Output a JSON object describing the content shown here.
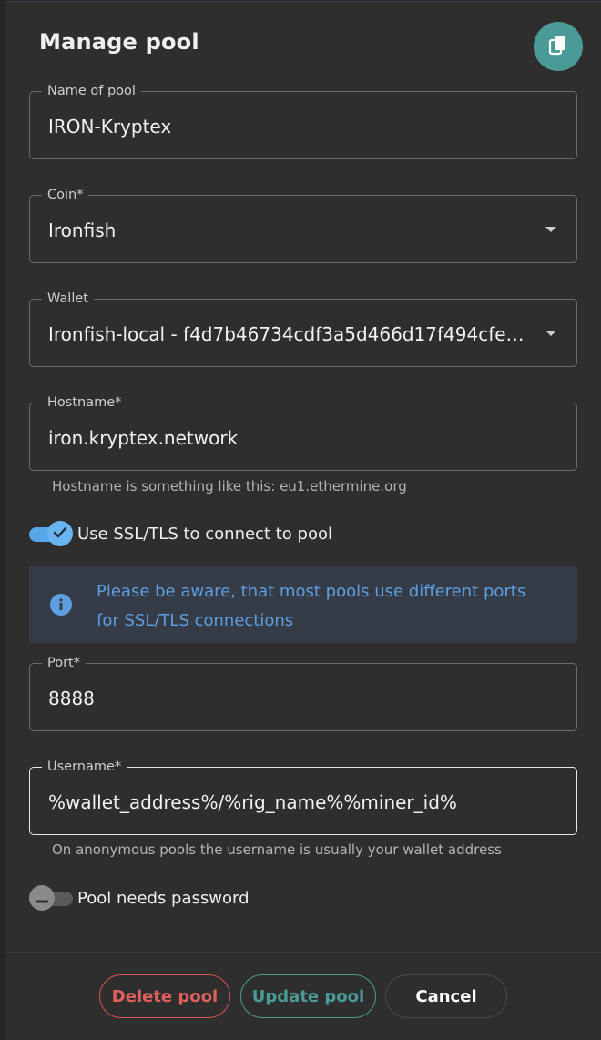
{
  "dialog": {
    "title": "Manage pool"
  },
  "fields": {
    "pool_name": {
      "label": "Name of pool",
      "value": "IRON-Kryptex"
    },
    "coin": {
      "label": "Coin*",
      "value": "Ironfish"
    },
    "wallet": {
      "label": "Wallet",
      "value": "Ironfish-local - f4d7b46734cdf3a5d466d17f494cfe…"
    },
    "hostname": {
      "label": "Hostname*",
      "value": "iron.kryptex.network",
      "helper": "Hostname is something like this: eu1.ethermine.org"
    },
    "port": {
      "label": "Port*",
      "value": "8888"
    },
    "username": {
      "label": "Username*",
      "value": "%wallet_address%/%rig_name%%miner_id%",
      "helper": "On anonymous pools the username is usually your wallet address"
    }
  },
  "toggles": {
    "ssl": {
      "label": "Use SSL/TLS to connect to pool",
      "checked": true
    },
    "password": {
      "label": "Pool needs password",
      "checked": false
    }
  },
  "alert": {
    "text": "Please be aware, that most pools use different ports for SSL/TLS connections"
  },
  "buttons": {
    "delete": "Delete pool",
    "update": "Update pool",
    "cancel": "Cancel"
  },
  "colors": {
    "accent_teal": "#4a9b97",
    "danger": "#d9534f",
    "info": "#5d9fe0",
    "switch_on": "#58a6ea"
  },
  "icons": {
    "copy": "copy-icon",
    "dropdown": "chevron-down-icon",
    "info": "info-icon",
    "check": "check-icon",
    "minus": "minus-icon"
  }
}
